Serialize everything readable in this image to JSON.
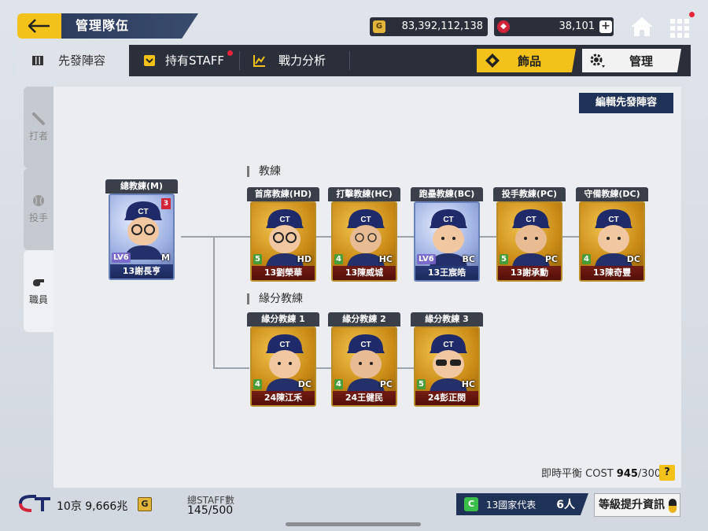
{
  "header": {
    "title": "管理隊伍",
    "gold": "83,392,112,138",
    "gold_icon": "G",
    "ruby": "38,101"
  },
  "tabs": {
    "lineup": "先發陣容",
    "own_staff": "持有STAFF",
    "power": "戰力分析",
    "jewel": "飾品",
    "manage": "管理"
  },
  "side": {
    "batter": "打者",
    "pitcher": "投手",
    "staff": "職員"
  },
  "panel": {
    "edit_button": "編輯先發陣容",
    "coaches_label": "教練",
    "bond_label": "緣分教練"
  },
  "manager": {
    "role": "總教練(M)",
    "name": "13謝長亨",
    "pos": "M",
    "level": "LV6",
    "rank": "3"
  },
  "coaches": [
    {
      "role": "首席教練(HD)",
      "name": "13劉榮華",
      "pos": "HD",
      "level": "5",
      "style": "gold"
    },
    {
      "role": "打擊教練(HC)",
      "name": "13陳威城",
      "pos": "HC",
      "level": "4",
      "style": "gold"
    },
    {
      "role": "跑壘教練(BC)",
      "name": "13王宸皓",
      "pos": "BC",
      "level": "LV6",
      "style": "blue"
    },
    {
      "role": "投手教練(PC)",
      "name": "13謝承勳",
      "pos": "PC",
      "level": "5",
      "style": "gold"
    },
    {
      "role": "守備教練(DC)",
      "name": "13陳奇豐",
      "pos": "DC",
      "level": "4",
      "style": "gold"
    }
  ],
  "bond": [
    {
      "role": "緣分教練 1",
      "name": "24陳江禾",
      "pos": "DC",
      "level": "4"
    },
    {
      "role": "緣分教練 2",
      "name": "24王健民",
      "pos": "PC",
      "level": "4"
    },
    {
      "role": "緣分教練 3",
      "name": "24彭正閔",
      "pos": "HC",
      "level": "5"
    }
  ],
  "footer": {
    "cost_label": "即時平衡 COST",
    "cost_value": "945",
    "cost_max": "/300",
    "help": "?",
    "team_logo": "CT",
    "money": "10京 9,666兆",
    "money_icon": "G",
    "staff_count_label": "總STAFF數",
    "staff_count": "145/500",
    "national_icon": "C",
    "national_label": "13國家代表",
    "national_count": "6人",
    "upgrade": "等級提升資訊"
  },
  "colors": {
    "accent_yellow": "#f3c21a",
    "navy": "#1f3358",
    "dark_bar": "#2a2f3a"
  }
}
